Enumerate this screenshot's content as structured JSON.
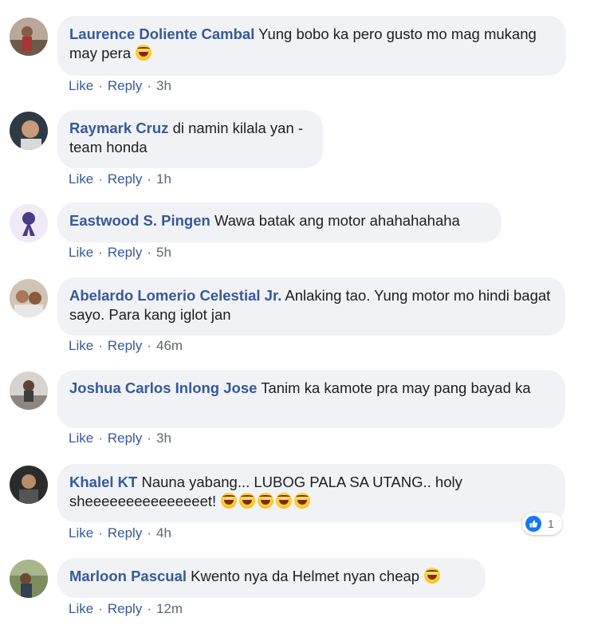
{
  "actions": {
    "like": "Like",
    "reply": "Reply",
    "separator": "·"
  },
  "comments": [
    {
      "author": "Laurence Doliente Cambal",
      "text": "Yung bobo ka pero gusto mo mag mukang may pera",
      "time": "3h",
      "emoji": "rolling-on-floor-laughing-icon",
      "emoji_count": 1
    },
    {
      "author": "Raymark Cruz",
      "text": "di namin kilala yan - team honda",
      "time": "1h"
    },
    {
      "author": "Eastwood S. Pingen",
      "text": "Wawa batak ang motor ahahahahaha",
      "time": "5h"
    },
    {
      "author": "Abelardo Lomerio Celestial Jr.",
      "text": "Anlaking tao. Yung motor mo hindi bagat sayo. Para kang iglot jan",
      "time": "46m"
    },
    {
      "author": "Joshua Carlos Inlong Jose",
      "text": "Tanim ka kamote pra may pang bayad ka",
      "time": "3h"
    },
    {
      "author": "Khalel KT",
      "text": "Nauna yabang... LUBOG PALA SA UTANG.. holy sheeeeeeeeeeeeeeet!",
      "time": "4h",
      "emoji": "rolling-on-floor-laughing-icon",
      "emoji_count": 5,
      "reaction": {
        "icon": "like-reaction-icon",
        "count": "1"
      }
    },
    {
      "author": "Marloon Pascual",
      "text": "Kwento nya da Helmet nyan cheap",
      "time": "12m",
      "emoji": "tears-of-joy-icon",
      "emoji_count": 1
    }
  ],
  "colors": {
    "author": "#385898",
    "bubble": "#f0f2f5",
    "like_blue": "#1877f2",
    "meta": "#606770"
  }
}
